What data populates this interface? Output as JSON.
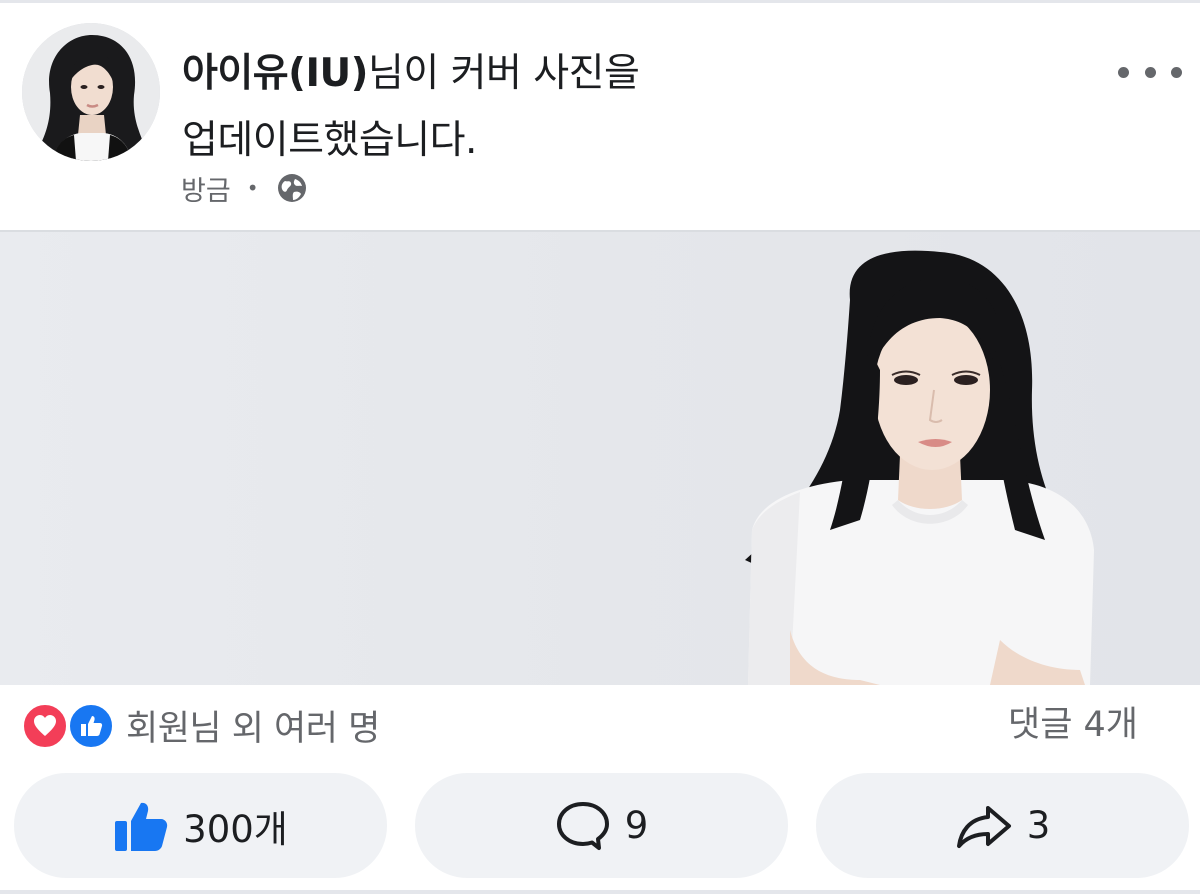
{
  "post": {
    "author": "아이유(IU)",
    "action_line1": "님이 커버 사진을",
    "action_line2": "업데이트했습니다.",
    "time": "방금",
    "separator": "•",
    "audience_icon": "globe-icon",
    "more_icon": "more-options-icon"
  },
  "reactions": {
    "icons": [
      "love-reaction-icon",
      "like-reaction-icon"
    ],
    "summary": "회원님 외 여러 명",
    "comments_text": "댓글 4개"
  },
  "actions": {
    "like": {
      "icon": "thumbs-up-icon",
      "count": "300개"
    },
    "comment": {
      "icon": "comment-bubble-icon",
      "count": "9"
    },
    "share": {
      "icon": "share-arrow-icon",
      "count": "3"
    }
  },
  "colors": {
    "accent": "#1877f2",
    "love": "#f33e58",
    "muted_text": "#65676b",
    "button_bg": "#f0f2f5"
  }
}
